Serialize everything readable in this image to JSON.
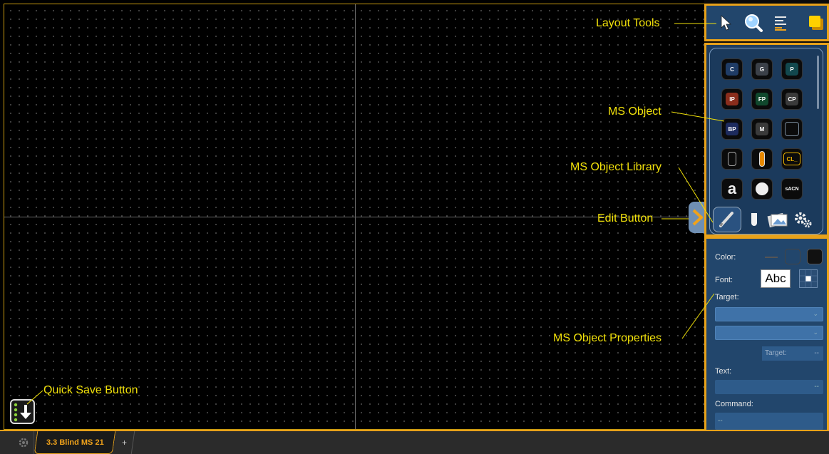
{
  "callouts": {
    "layout_tools": "Layout Tools",
    "ms_object": "MS Object",
    "ms_object_library": "MS Object Library",
    "edit_button": "Edit Button",
    "ms_object_properties": "MS Object Properties",
    "quick_save_button": "Quick Save Button"
  },
  "library": {
    "objects": [
      {
        "label": "C",
        "color": "#1f3c66"
      },
      {
        "label": "G",
        "color": "#3b4048"
      },
      {
        "label": "P",
        "color": "#12484e"
      },
      {
        "label": "IP",
        "color": "#8a2d1c"
      },
      {
        "label": "FP",
        "color": "#10482d"
      },
      {
        "label": "CP",
        "color": "#3a3a3a"
      },
      {
        "label": "BP",
        "color": "#1d2b5e"
      },
      {
        "label": "M",
        "color": "#3a3a3a"
      },
      {
        "label": "",
        "color": "#0b0b0b"
      },
      {
        "label": "",
        "color": "#0b0b0b"
      },
      {
        "label": "",
        "color": "#0b0b0b"
      },
      {
        "label": "CL_",
        "color": "#0b0b0b"
      },
      {
        "label": "a",
        "color": "#0b0b0b"
      },
      {
        "label": "",
        "color": "#0b0b0b"
      },
      {
        "label": "sACN",
        "color": "#0b0b0b"
      }
    ]
  },
  "properties": {
    "color_label": "Color:",
    "font_label": "Font:",
    "font_sample": "Abc",
    "target_label": "Target:",
    "target_sub_label": "Target:",
    "target_sub_value": "--",
    "text_label": "Text:",
    "text_value": "--",
    "command_label": "Command:",
    "command_value": "--"
  },
  "tabs": {
    "active": "3.3 Blind MS 21",
    "add": "+"
  },
  "colors": {
    "accent": "#e8a21a",
    "callout": "#f2e20a",
    "panel": "#22466c"
  }
}
